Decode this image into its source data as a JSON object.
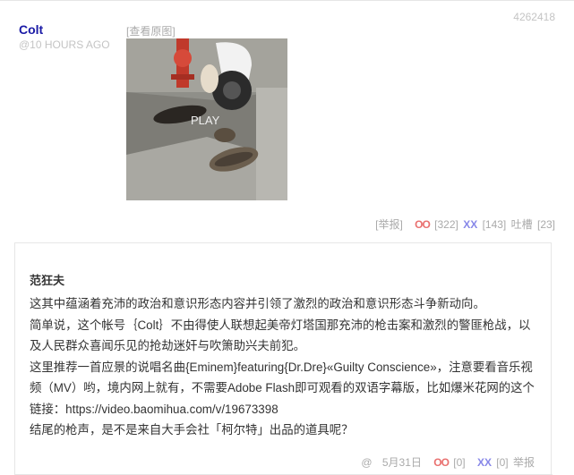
{
  "post": {
    "author": "Colt",
    "time": "@10 HOURS AGO",
    "id": "4262418",
    "view_original": "[查看原图]",
    "thumbnail_label": "PLAY",
    "report": "[举报]",
    "oo_icon": "OO",
    "oo_count": "[322]",
    "xx_icon": "XX",
    "xx_count": "[143]",
    "tucao_label": "吐槽",
    "tucao_count": "[23]"
  },
  "comment": {
    "author": "范狂夫",
    "lines": [
      "这其中蕴涵着充沛的政治和意识形态内容并引领了激烈的政治和意识形态斗争新动向。",
      "简单说，这个帐号｛Colt｝不由得使人联想起美帝灯塔国那充沛的枪击案和激烈的警匪枪战，以及人民群众喜闻乐见的抢劫迷奸与吹箫助兴夫前犯。",
      "这里推荐一首应景的说唱名曲{Eminem}featuring{Dr.Dre}«Guilty Conscience»，注意要看音乐视频（MV）哟，境内网上就有，不需要Adobe Flash即可观看的双语字幕版，比如爆米花网的这个链接：https://video.baomihua.com/v/19673398",
      "结尾的枪声，是不是来自大手会社「柯尔特」出品的道具呢？"
    ],
    "reply_icon": "@",
    "date": "5月31日",
    "oo_icon": "OO",
    "oo_count": "[0]",
    "xx_icon": "XX",
    "xx_count": "[0]",
    "report": "举报"
  },
  "colors": {
    "author": "#1a1aa6",
    "oo": "#e9706f",
    "xx": "#8787e8",
    "muted": "#aaaaaa"
  }
}
